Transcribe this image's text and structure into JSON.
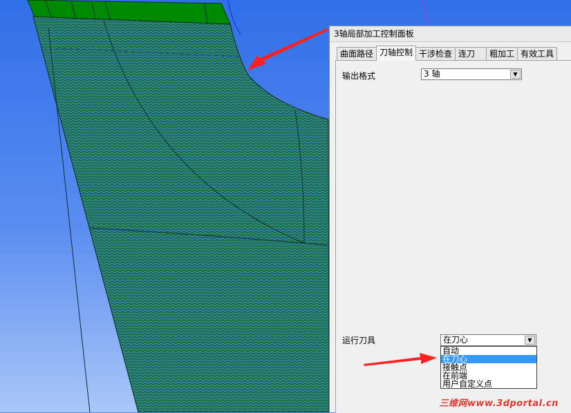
{
  "panel": {
    "title": "3轴局部加工控制面板",
    "tabs": [
      {
        "label": "曲面路径"
      },
      {
        "label": "刀轴控制"
      },
      {
        "label": "干涉检查"
      },
      {
        "label": "连刀"
      },
      {
        "label": "粗加工"
      },
      {
        "label": "有效工具"
      }
    ],
    "active_tab": 1,
    "output_format": {
      "label": "输出格式",
      "value": "3 轴"
    },
    "run_tool": {
      "label": "运行刀具",
      "value": "在刀心",
      "options": [
        "自动",
        "在刀心",
        "接触点",
        "在前端",
        "用户自定义点"
      ],
      "selected_index": 1
    }
  },
  "watermark": "三维网www.3dportal.cn",
  "colors": {
    "sky_top": "#2f6fe8",
    "sky_bottom": "#9ec0f7",
    "mesh": "#1f7a44",
    "top_band": "#008a00",
    "selection": "#3399ff",
    "arrow": "#ff2020"
  }
}
